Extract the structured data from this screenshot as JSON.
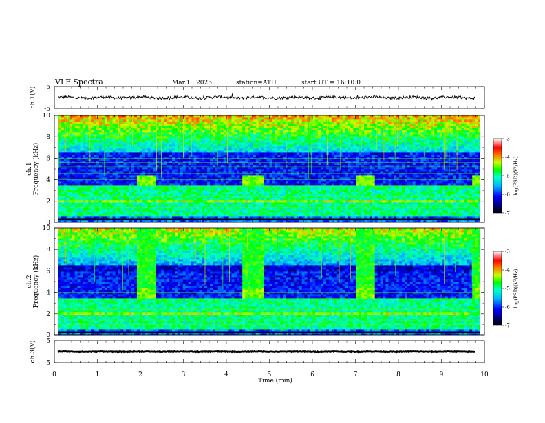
{
  "header": {
    "title": "VLF  Spectra",
    "date": "Mar.1  , 2026",
    "station": "station=ATH",
    "start_ut": "start  UT  =   16:10:0"
  },
  "chart_data": [
    {
      "id": "ch1-time-series",
      "type": "line",
      "ylabel": "ch.1(V)",
      "ylim": [
        -5,
        5
      ],
      "yticks": [
        "5",
        "-5"
      ],
      "xlim": [
        0,
        10
      ],
      "baseline": 0,
      "noise_amplitude": 0.6,
      "color": "#000000"
    },
    {
      "id": "ch1-spectrogram",
      "type": "heatmap",
      "ylabel": "ch.1\nFrequency  (kHz)",
      "ylim": [
        0,
        10
      ],
      "yticks": [
        "0",
        "2",
        "4",
        "6",
        "8",
        "10"
      ],
      "xlim": [
        0,
        10
      ],
      "colorbar": {
        "label": "log(PSD)(V²/Hz)",
        "range": [
          -7,
          -3
        ],
        "ticks": [
          "-3",
          "-4",
          "-5",
          "-6",
          "-7"
        ]
      },
      "transmitter_bursts": [
        {
          "start": 1.8,
          "end": 2.25,
          "fmin": 3.4,
          "fmax": 4.4
        },
        {
          "start": 4.3,
          "end": 4.75,
          "fmin": 3.4,
          "fmax": 4.4
        },
        {
          "start": 6.9,
          "end": 7.35,
          "fmin": 3.4,
          "fmax": 4.4
        },
        {
          "start": 9.6,
          "end": 9.8,
          "fmin": 3.4,
          "fmax": 4.4
        }
      ]
    },
    {
      "id": "ch2-spectrogram",
      "type": "heatmap",
      "ylabel": "ch.2\nFrequency  (kHz)",
      "ylim": [
        0,
        10
      ],
      "yticks": [
        "0",
        "2",
        "4",
        "6",
        "8",
        "10"
      ],
      "xlim": [
        0,
        10
      ],
      "colorbar": {
        "label": "log(PSD)(V²/Hz)",
        "range": [
          -7,
          -3
        ],
        "ticks": [
          "-3",
          "-4",
          "-5",
          "-6",
          "-7"
        ]
      },
      "transmitter_bursts": [
        {
          "start": 1.8,
          "end": 2.25,
          "fmin": 3.4,
          "fmax": 10
        },
        {
          "start": 4.3,
          "end": 4.75,
          "fmin": 3.4,
          "fmax": 10
        },
        {
          "start": 6.9,
          "end": 7.35,
          "fmin": 3.4,
          "fmax": 10
        },
        {
          "start": 9.6,
          "end": 9.8,
          "fmin": 3.4,
          "fmax": 10
        }
      ]
    },
    {
      "id": "ch3-time-series",
      "type": "line",
      "ylabel": "ch.3(V)",
      "ylim": [
        -5,
        5
      ],
      "yticks": [
        "5",
        "-5"
      ],
      "xlim": [
        0,
        10
      ],
      "baseline": 0,
      "noise_amplitude": 0.15,
      "color": "#000000"
    }
  ],
  "x_axis": {
    "xlabel": "Time  (min)",
    "ticks": [
      "0",
      "1",
      "2",
      "3",
      "4",
      "5",
      "6",
      "7",
      "8",
      "9",
      "10"
    ]
  }
}
